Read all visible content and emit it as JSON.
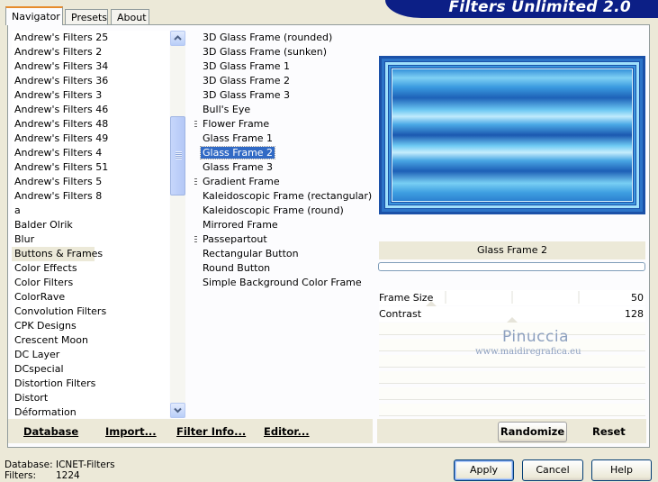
{
  "tabs": [
    {
      "label": "Navigator"
    },
    {
      "label": "Presets"
    },
    {
      "label": "About"
    }
  ],
  "banner": {
    "title": "Filters Unlimited 2.0"
  },
  "categories": [
    "Andrew's Filters 25",
    "Andrew's Filters 2",
    "Andrew's Filters 34",
    "Andrew's Filters 36",
    "Andrew's Filters 3",
    "Andrew's Filters 46",
    "Andrew's Filters 48",
    "Andrew's Filters 49",
    "Andrew's Filters 4",
    "Andrew's Filters 51",
    "Andrew's Filters 5",
    "Andrew's Filters 8",
    "a",
    "Balder Olrik",
    "Blur",
    "Buttons & Frames",
    "Color Effects",
    "Color Filters",
    "ColorRave",
    "Convolution Filters",
    "CPK Designs",
    "Crescent Moon",
    "DC Layer",
    "DCspecial",
    "Distortion Filters",
    "Distort",
    "Déformation"
  ],
  "selected_category": "Buttons & Frames",
  "filters": [
    {
      "label": "3D Glass Frame (rounded)",
      "grip": false
    },
    {
      "label": "3D Glass Frame (sunken)",
      "grip": false
    },
    {
      "label": "3D Glass Frame 1",
      "grip": false
    },
    {
      "label": "3D Glass Frame 2",
      "grip": false
    },
    {
      "label": "3D Glass Frame 3",
      "grip": false
    },
    {
      "label": "Bull's Eye",
      "grip": false
    },
    {
      "label": "Flower Frame",
      "grip": true
    },
    {
      "label": "Glass Frame 1",
      "grip": false
    },
    {
      "label": "Glass Frame 2",
      "grip": false
    },
    {
      "label": "Glass Frame 3",
      "grip": false
    },
    {
      "label": "Gradient Frame",
      "grip": true
    },
    {
      "label": "Kaleidoscopic Frame (rectangular)",
      "grip": false
    },
    {
      "label": "Kaleidoscopic Frame (round)",
      "grip": false
    },
    {
      "label": "Mirrored Frame",
      "grip": false
    },
    {
      "label": "Passepartout",
      "grip": true
    },
    {
      "label": "Rectangular Button",
      "grip": false
    },
    {
      "label": "Round Button",
      "grip": false
    },
    {
      "label": "Simple Background Color Frame",
      "grip": false
    }
  ],
  "selected_filter": "Glass Frame 2",
  "panel_buttons": {
    "database": "Database",
    "import": "Import...",
    "filter_info": "Filter Info...",
    "editor": "Editor..."
  },
  "preview": {
    "filter_name": "Glass Frame 2"
  },
  "params": [
    {
      "label": "Frame Size",
      "value": "50",
      "level": 50
    },
    {
      "label": "Contrast",
      "value": "128",
      "level": 128
    }
  ],
  "watermark": {
    "line1": "Pinuccia",
    "line2": "www.maidiregrafica.eu"
  },
  "actions": {
    "randomize": "Randomize",
    "reset": "Reset"
  },
  "status": {
    "database_label": "Database:",
    "database_value": "ICNET-Filters",
    "filters_label": "Filters:",
    "filters_value": "1224"
  },
  "dialog_buttons": {
    "apply": "Apply",
    "cancel": "Cancel",
    "help": "Help"
  },
  "colors": {
    "accent": "#316ac5",
    "banner": "#0c1f86",
    "tab_highlight": "#e68b2c"
  }
}
